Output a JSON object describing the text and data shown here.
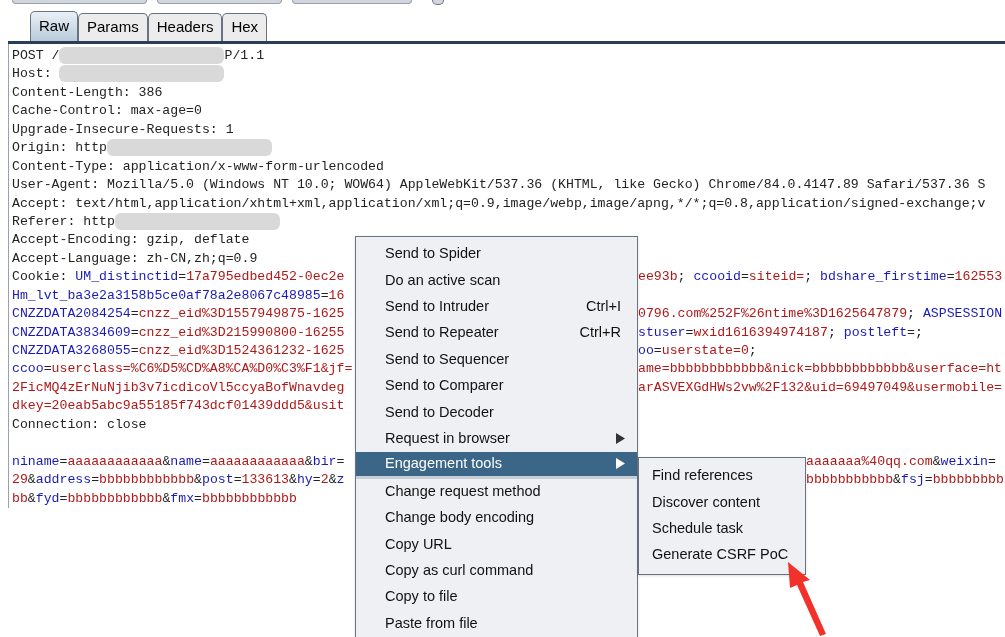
{
  "tabs": [
    {
      "label": "Raw",
      "selected": true
    },
    {
      "label": "Params",
      "selected": false
    },
    {
      "label": "Headers",
      "selected": false
    },
    {
      "label": "Hex",
      "selected": false
    }
  ],
  "lines": [
    {
      "left": [
        {
          "kind": "plain",
          "text": "POST /"
        },
        {
          "kind": "blur"
        },
        {
          "kind": "plain",
          "text": "P/1.1"
        }
      ]
    },
    {
      "left": [
        {
          "kind": "plain",
          "text": "Host: "
        },
        {
          "kind": "blur"
        }
      ]
    },
    {
      "left": [
        {
          "kind": "plain",
          "text": "Content-Length: 386"
        }
      ]
    },
    {
      "left": [
        {
          "kind": "plain",
          "text": "Cache-Control: max-age=0"
        }
      ]
    },
    {
      "left": [
        {
          "kind": "plain",
          "text": "Upgrade-Insecure-Requests: 1"
        }
      ]
    },
    {
      "left": [
        {
          "kind": "plain",
          "text": "Origin: http"
        },
        {
          "kind": "blur"
        }
      ]
    },
    {
      "left": [
        {
          "kind": "plain",
          "text": "Content-Type: application/x-www-form-urlencoded"
        }
      ]
    },
    {
      "left": [
        {
          "kind": "plain",
          "text": "User-Agent: Mozilla/5.0 (Windows NT 10.0; WOW64) AppleWebKit/537.36 (KHTML, like Gecko) Chrome/84.0.4147.89 Safari/537.36 S"
        }
      ]
    },
    {
      "left": [
        {
          "kind": "plain",
          "text": "Accept: text/html,application/xhtml+xml,application/xml;q=0.9,image/webp,image/apng,*/*;q=0.8,application/signed-exchange;v"
        }
      ]
    },
    {
      "left": [
        {
          "kind": "plain",
          "text": "Referer: http"
        },
        {
          "kind": "blur"
        }
      ]
    },
    {
      "left": [
        {
          "kind": "plain",
          "text": "Accept-Encoding: gzip, deflate"
        }
      ]
    },
    {
      "left": [
        {
          "kind": "plain",
          "text": "Accept-Language: zh-CN,zh;q=0.9"
        }
      ]
    },
    {
      "left": [
        {
          "kind": "plain",
          "text": "Cookie: "
        },
        {
          "kind": "key",
          "text": "UM_distinctid"
        },
        {
          "kind": "plain",
          "text": "="
        },
        {
          "kind": "value",
          "text": "17a795edbed452-0ec2e"
        }
      ],
      "right_of_menu": [
        {
          "kind": "value",
          "text": "ee93b"
        },
        {
          "kind": "plain",
          "text": "; "
        },
        {
          "kind": "key",
          "text": "ccooid"
        },
        {
          "kind": "plain",
          "text": "="
        },
        {
          "kind": "value",
          "text": "siteid="
        },
        {
          "kind": "plain",
          "text": "; "
        },
        {
          "kind": "key",
          "text": "bdshare_firstime"
        },
        {
          "kind": "plain",
          "text": "="
        },
        {
          "kind": "value",
          "text": "162553"
        }
      ]
    },
    {
      "left": [
        {
          "kind": "key",
          "text": "Hm_lvt_ba3e2a3158b5ce0af78a2e8067c48985"
        },
        {
          "kind": "plain",
          "text": "="
        },
        {
          "kind": "value",
          "text": "16"
        }
      ]
    },
    {
      "left": [
        {
          "kind": "key",
          "text": "CNZZDATA2084254"
        },
        {
          "kind": "plain",
          "text": "="
        },
        {
          "kind": "value",
          "text": "cnzz_eid%3D1557949875-1625"
        }
      ],
      "right_of_menu": [
        {
          "kind": "value",
          "text": "0796.com%252F%26ntime%3D1625647879"
        },
        {
          "kind": "plain",
          "text": "; "
        },
        {
          "kind": "key",
          "text": "ASPSESSION"
        }
      ]
    },
    {
      "left": [
        {
          "kind": "key",
          "text": "CNZZDATA3834609"
        },
        {
          "kind": "plain",
          "text": "="
        },
        {
          "kind": "value",
          "text": "cnzz_eid%3D215990800-16255"
        }
      ],
      "right_of_menu": [
        {
          "kind": "key",
          "text": "stuser"
        },
        {
          "kind": "plain",
          "text": "="
        },
        {
          "kind": "value",
          "text": "wxid1616394974187"
        },
        {
          "kind": "plain",
          "text": "; "
        },
        {
          "kind": "key",
          "text": "postleft"
        },
        {
          "kind": "plain",
          "text": "=;"
        }
      ]
    },
    {
      "left": [
        {
          "kind": "key",
          "text": "CNZZDATA3268055"
        },
        {
          "kind": "plain",
          "text": "="
        },
        {
          "kind": "value",
          "text": "cnzz_eid%3D1524361232-1625"
        }
      ],
      "right_of_menu": [
        {
          "kind": "key",
          "text": "oo"
        },
        {
          "kind": "plain",
          "text": "="
        },
        {
          "kind": "value",
          "text": "userstate=0"
        },
        {
          "kind": "plain",
          "text": ";"
        }
      ]
    },
    {
      "left": [
        {
          "kind": "key",
          "text": "ccoo"
        },
        {
          "kind": "plain",
          "text": "="
        },
        {
          "kind": "value",
          "text": "userclass=%C6%D5%CD%A8%CA%D0%C3%F1&jf="
        }
      ],
      "right_of_menu": [
        {
          "kind": "value",
          "text": "ame=bbbbbbbbbbbb&nick=bbbbbbbbbbbb&userface=ht"
        }
      ]
    },
    {
      "left": [
        {
          "kind": "value",
          "text": "2FicMQ4zErNuNjib3v7icdicoVl5ccyaBofWnavdeg"
        }
      ],
      "right_of_menu": [
        {
          "kind": "value",
          "text": "arASVEXGdHWs2vw%2F132&uid=69497049&usermobile="
        }
      ]
    },
    {
      "left": [
        {
          "kind": "value",
          "text": "dkey=20eab5abc9a55185f743dcf01439ddd5&usit"
        }
      ]
    },
    {
      "left": [
        {
          "kind": "plain",
          "text": "Connection: close"
        }
      ]
    }
  ],
  "body_lines": [
    {
      "left": [
        {
          "kind": "key",
          "text": "niname"
        },
        {
          "kind": "plain",
          "text": "="
        },
        {
          "kind": "value",
          "text": "aaaaaaaaaaaa"
        },
        {
          "kind": "plain",
          "text": "&"
        },
        {
          "kind": "key",
          "text": "name"
        },
        {
          "kind": "plain",
          "text": "="
        },
        {
          "kind": "value",
          "text": "aaaaaaaaaaaa"
        },
        {
          "kind": "plain",
          "text": "&"
        },
        {
          "kind": "key",
          "text": "bir"
        },
        {
          "kind": "plain",
          "text": "="
        }
      ],
      "right_of_submenu": [
        {
          "kind": "value",
          "text": "aaaaaaa%40qq.com"
        },
        {
          "kind": "plain",
          "text": "&"
        },
        {
          "kind": "key",
          "text": "weixin"
        },
        {
          "kind": "plain",
          "text": "="
        }
      ]
    },
    {
      "left": [
        {
          "kind": "value",
          "text": "29"
        },
        {
          "kind": "plain",
          "text": "&"
        },
        {
          "kind": "key",
          "text": "address"
        },
        {
          "kind": "plain",
          "text": "="
        },
        {
          "kind": "value",
          "text": "bbbbbbbbbbbb"
        },
        {
          "kind": "plain",
          "text": "&"
        },
        {
          "kind": "key",
          "text": "post"
        },
        {
          "kind": "plain",
          "text": "="
        },
        {
          "kind": "value",
          "text": "133613"
        },
        {
          "kind": "plain",
          "text": "&"
        },
        {
          "kind": "key",
          "text": "hy"
        },
        {
          "kind": "plain",
          "text": "="
        },
        {
          "kind": "value",
          "text": "2"
        },
        {
          "kind": "plain",
          "text": "&"
        },
        {
          "kind": "key",
          "text": "z"
        }
      ],
      "right_of_submenu": [
        {
          "kind": "value",
          "text": "bbbbbbbbbbb"
        },
        {
          "kind": "plain",
          "text": "&"
        },
        {
          "kind": "key",
          "text": "fsj"
        },
        {
          "kind": "plain",
          "text": "="
        },
        {
          "kind": "value",
          "text": "bbbbbbbbb"
        }
      ]
    },
    {
      "left": [
        {
          "kind": "value",
          "text": "bb"
        },
        {
          "kind": "plain",
          "text": "&"
        },
        {
          "kind": "key",
          "text": "fyd"
        },
        {
          "kind": "plain",
          "text": "="
        },
        {
          "kind": "value",
          "text": "bbbbbbbbbbbb"
        },
        {
          "kind": "plain",
          "text": "&"
        },
        {
          "kind": "key",
          "text": "fmx"
        },
        {
          "kind": "plain",
          "text": "="
        },
        {
          "kind": "value",
          "text": "bbbbbbbbbbbb"
        }
      ]
    }
  ],
  "context_menu": [
    {
      "label": "Send to Spider",
      "selected": false,
      "submenu": false
    },
    {
      "label": "Do an active scan",
      "selected": false,
      "submenu": false
    },
    {
      "label": "Send to Intruder",
      "shortcut": "Ctrl+I",
      "selected": false,
      "submenu": false
    },
    {
      "label": "Send to Repeater",
      "shortcut": "Ctrl+R",
      "selected": false,
      "submenu": false
    },
    {
      "label": "Send to Sequencer",
      "selected": false,
      "submenu": false
    },
    {
      "label": "Send to Comparer",
      "selected": false,
      "submenu": false
    },
    {
      "label": "Send to Decoder",
      "selected": false,
      "submenu": false
    },
    {
      "label": "Request in browser",
      "selected": false,
      "submenu": true
    },
    {
      "label": "Engagement tools",
      "selected": true,
      "submenu": true
    },
    {
      "label": "Change request method",
      "selected": false,
      "submenu": false
    },
    {
      "label": "Change body encoding",
      "selected": false,
      "submenu": false
    },
    {
      "label": "Copy URL",
      "selected": false,
      "submenu": false
    },
    {
      "label": "Copy as curl command",
      "selected": false,
      "submenu": false
    },
    {
      "label": "Copy to file",
      "selected": false,
      "submenu": false
    },
    {
      "label": "Paste from file",
      "selected": false,
      "submenu": false
    }
  ],
  "submenu": [
    {
      "label": "Find references"
    },
    {
      "label": "Discover content"
    },
    {
      "label": "Schedule task"
    },
    {
      "label": "Generate CSRF PoC"
    }
  ]
}
